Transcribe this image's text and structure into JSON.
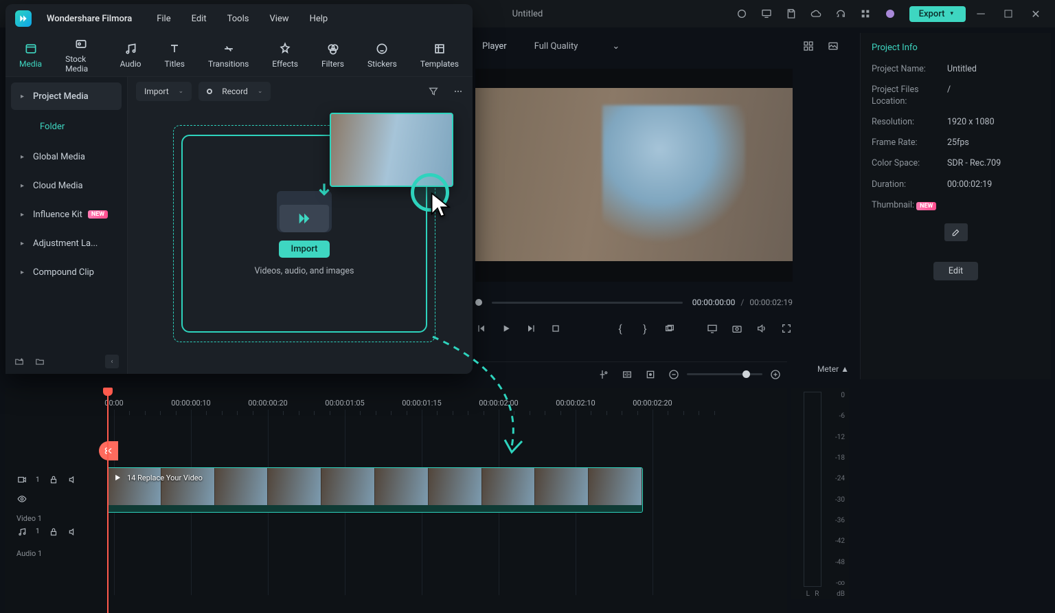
{
  "app": {
    "name": "Wondershare Filmora",
    "window_title": "Untitled"
  },
  "topbar": {
    "export": "Export"
  },
  "menus": [
    "File",
    "Edit",
    "Tools",
    "View",
    "Help"
  ],
  "tabs": [
    {
      "id": "media",
      "label": "Media",
      "active": true
    },
    {
      "id": "stock",
      "label": "Stock Media"
    },
    {
      "id": "audio",
      "label": "Audio"
    },
    {
      "id": "titles",
      "label": "Titles"
    },
    {
      "id": "transitions",
      "label": "Transitions"
    },
    {
      "id": "effects",
      "label": "Effects"
    },
    {
      "id": "filters",
      "label": "Filters"
    },
    {
      "id": "stickers",
      "label": "Stickers"
    },
    {
      "id": "templates",
      "label": "Templates"
    }
  ],
  "media_toolbar": {
    "import": "Import",
    "record": "Record"
  },
  "sidebar": {
    "header": "Project Media",
    "folder": "Folder",
    "items": [
      {
        "label": "Global Media"
      },
      {
        "label": "Cloud Media"
      },
      {
        "label": "Influence Kit",
        "badge": "NEW"
      },
      {
        "label": "Adjustment La..."
      },
      {
        "label": "Compound Clip"
      }
    ]
  },
  "dropzone": {
    "button": "Import",
    "hint": "Videos, audio, and images"
  },
  "player": {
    "tab": "Player",
    "quality": "Full Quality",
    "current": "00:00:00:00",
    "duration": "00:00:02:19"
  },
  "project_info": {
    "title": "Project Info",
    "rows": [
      {
        "k": "Project Name:",
        "v": "Untitled"
      },
      {
        "k": "Project Files Location:",
        "v": "/"
      },
      {
        "k": "Resolution:",
        "v": "1920 x 1080"
      },
      {
        "k": "Frame Rate:",
        "v": "25fps"
      },
      {
        "k": "Color Space:",
        "v": "SDR - Rec.709"
      },
      {
        "k": "Duration:",
        "v": "00:00:02:19"
      }
    ],
    "thumbnail_label": "Thumbnail:",
    "thumbnail_badge": "NEW",
    "edit": "Edit"
  },
  "timeline": {
    "meter_label": "Meter ▲",
    "ticks": [
      "00:00",
      "00:00:00:10",
      "00:00:00:20",
      "00:00:01:05",
      "00:00:01:15",
      "00:00:02:00",
      "00:00:02:10",
      "00:00:02:20"
    ],
    "video_track": "Video 1",
    "audio_track": "Audio 1",
    "clip_label": "14 Replace Your Video",
    "meter_scale": [
      "0",
      "-6",
      "-12",
      "-18",
      "-24",
      "-30",
      "-36",
      "-42",
      "-48",
      "-∞"
    ],
    "meter_db": "dB",
    "meter_L": "L",
    "meter_R": "R"
  }
}
